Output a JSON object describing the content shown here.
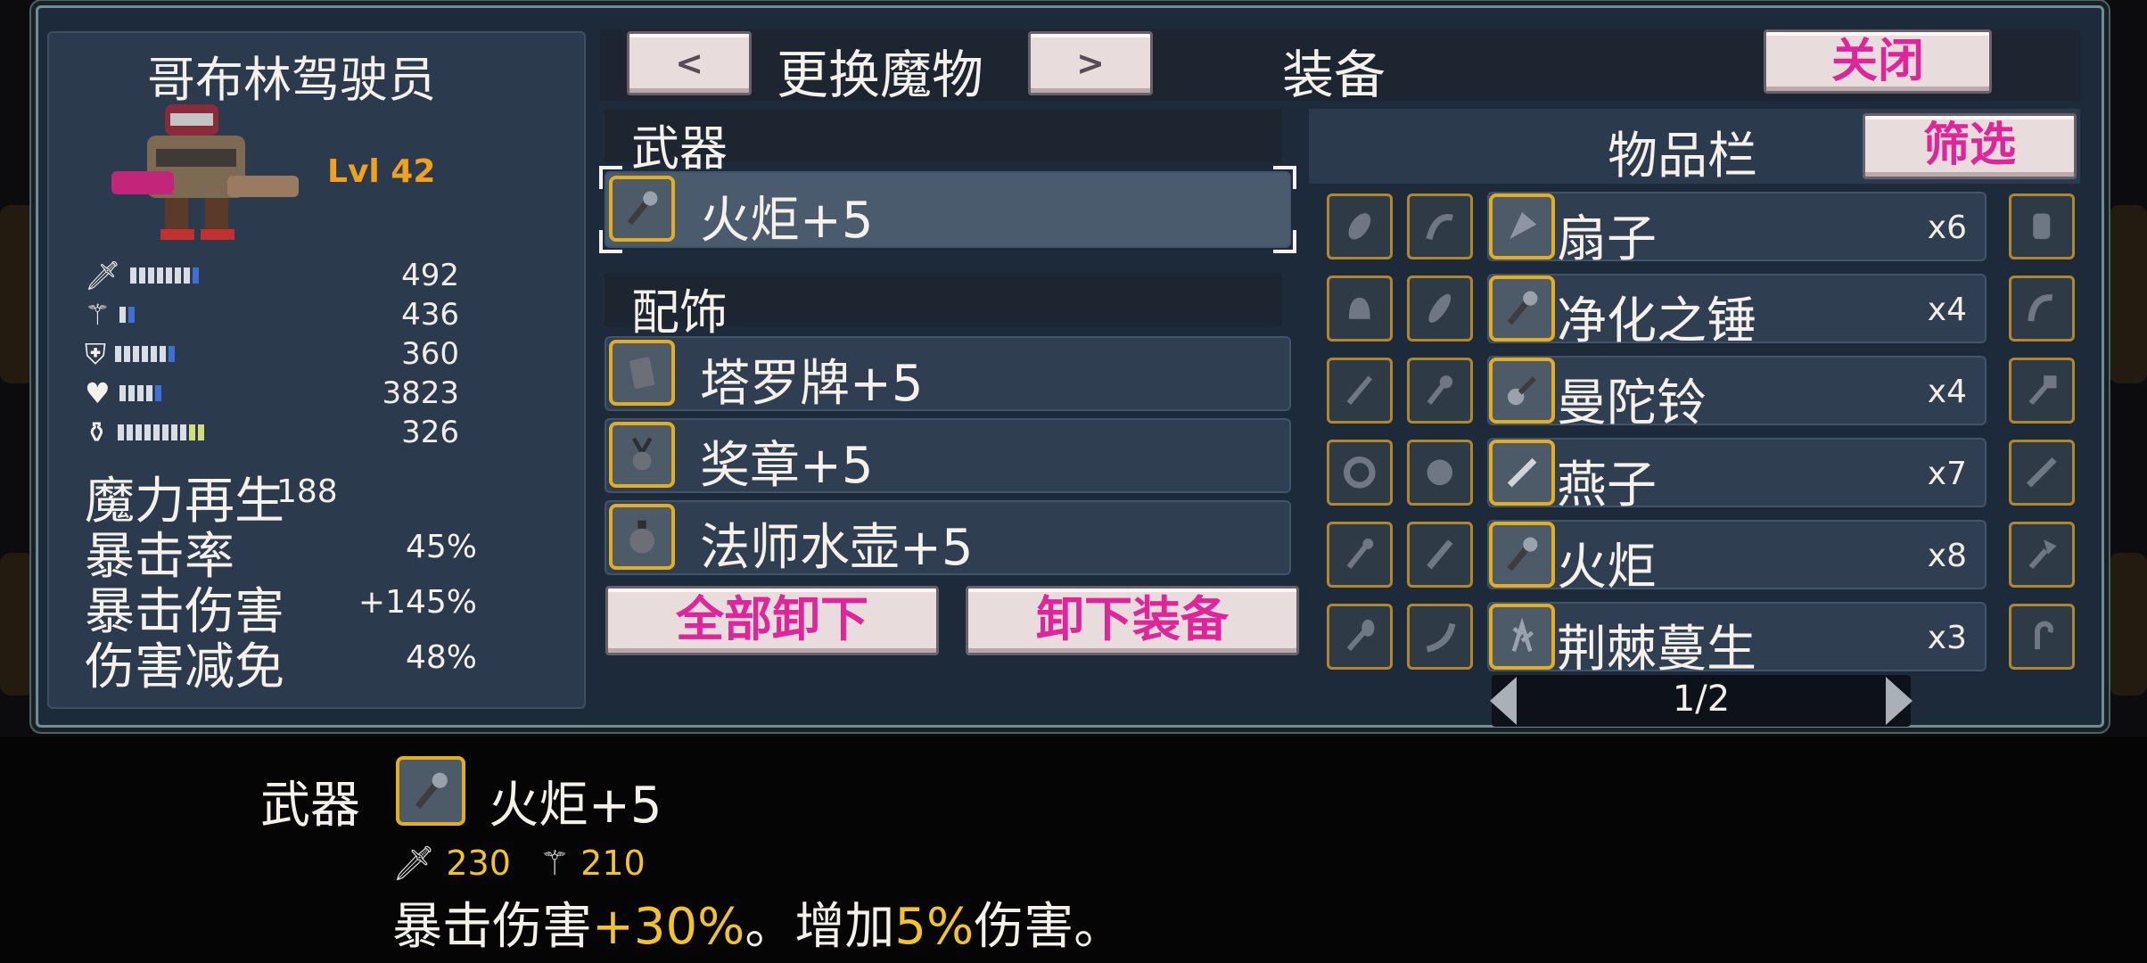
{
  "monster": {
    "name": "哥布林驾驶员",
    "level": "Lvl 42",
    "stats": [
      {
        "icon": "sword-icon",
        "value": "492",
        "filled": 7,
        "blue": 1,
        "yellow": 0
      },
      {
        "icon": "staff-icon",
        "value": "436",
        "filled": 1,
        "blue": 1,
        "yellow": 0
      },
      {
        "icon": "shield-icon",
        "value": "360",
        "filled": 6,
        "blue": 1,
        "yellow": 0
      },
      {
        "icon": "heart-icon",
        "value": "3823",
        "filled": 4,
        "blue": 1,
        "yellow": 0
      },
      {
        "icon": "potion-icon",
        "value": "326",
        "filled": 8,
        "blue": 0,
        "yellow": 2
      }
    ],
    "secondary": [
      {
        "label": "魔力再生",
        "value": "188"
      },
      {
        "label": "暴击率",
        "value": "45%"
      },
      {
        "label": "暴击伤害",
        "value": "+145%"
      },
      {
        "label": "伤害减免",
        "value": "48%"
      }
    ]
  },
  "header": {
    "prev": "<",
    "change_monster": "更换魔物",
    "next": ">",
    "equipment": "装备",
    "close": "关闭"
  },
  "equip": {
    "weapon_header": "武器",
    "weapon": {
      "name": "火炬+5",
      "icon": "torch-icon"
    },
    "accessory_header": "配饰",
    "accessories": [
      {
        "name": "塔罗牌+5",
        "icon": "tarot-card-icon"
      },
      {
        "name": "奖章+5",
        "icon": "medal-icon"
      },
      {
        "name": "法师水壶+5",
        "icon": "flask-icon"
      }
    ],
    "unequip_all": "全部卸下",
    "unequip": "卸下装备"
  },
  "inventory": {
    "title": "物品栏",
    "filter": "筛选",
    "rows": [
      {
        "name": "扇子",
        "count": "x6",
        "icon": "fan-icon"
      },
      {
        "name": "净化之锤",
        "count": "x4",
        "icon": "hammer-icon"
      },
      {
        "name": "曼陀铃",
        "count": "x4",
        "icon": "mandolin-icon"
      },
      {
        "name": "燕子",
        "count": "x7",
        "icon": "swallow-icon"
      },
      {
        "name": "火炬",
        "count": "x8",
        "icon": "torch-icon"
      },
      {
        "name": "荆棘蔓生",
        "count": "x3",
        "icon": "thorn-icon"
      }
    ],
    "left_icons": [
      [
        "leaf-icon",
        "claw-icon"
      ],
      [
        "bell-icon",
        "feather-icon"
      ],
      [
        "dagger-icon",
        "wand-icon"
      ],
      [
        "gear-ring-icon",
        "orb-icon"
      ],
      [
        "rod-icon",
        "blade-icon"
      ],
      [
        "brush-icon",
        "horn-icon"
      ]
    ],
    "right_icons": [
      "glove-icon",
      "sickle-icon",
      "mace-icon",
      "sword-icon",
      "axe-icon",
      "hook-icon"
    ],
    "page": "1/2"
  },
  "detail": {
    "category": "武器",
    "name": "火炬+5",
    "icon": "torch-icon",
    "atk": "230",
    "matk": "210",
    "desc_a": "暴击伤害",
    "desc_b": "+30%",
    "desc_c": "。增加",
    "desc_d": "5%",
    "desc_e": "伤害。"
  },
  "colors": {
    "accent": "#e0249a",
    "gold": "#e3ad1f",
    "level": "#f0a21d",
    "panel": "#2b3b4d"
  }
}
